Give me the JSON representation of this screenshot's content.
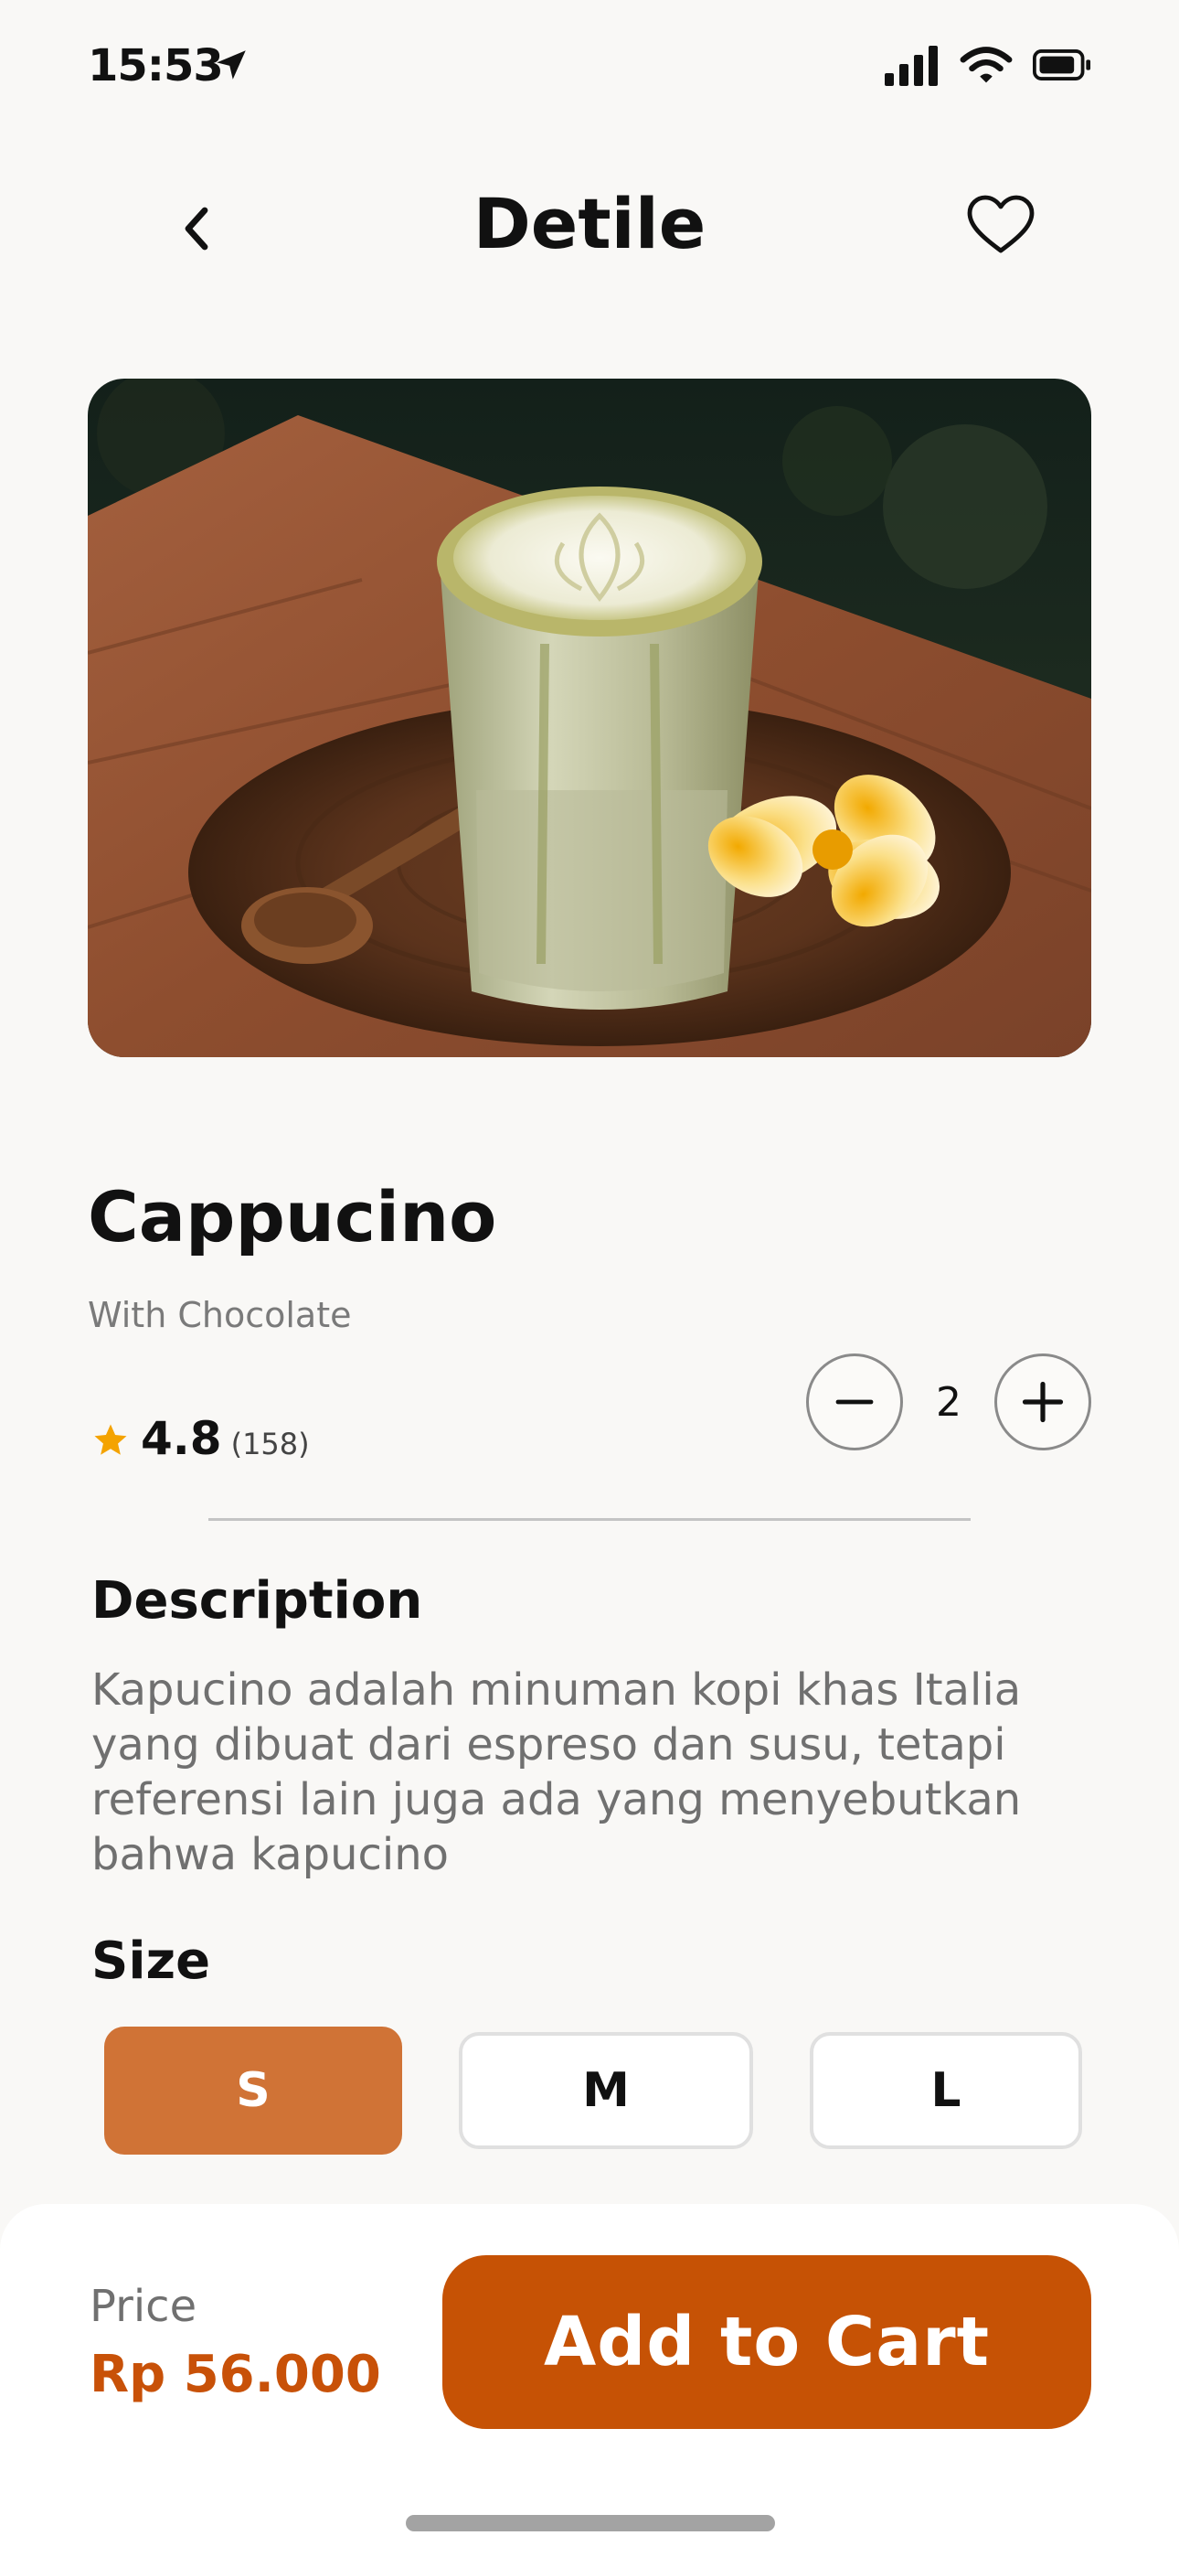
{
  "status_bar": {
    "time": "15:53"
  },
  "header": {
    "title": "Detile"
  },
  "product": {
    "name": "Cappucino",
    "subtitle": "With Chocolate",
    "rating": "4.8",
    "rating_count": "(158)",
    "quantity": "2"
  },
  "description": {
    "title": "Description",
    "text": "Kapucino adalah minuman kopi khas Italia yang dibuat dari espreso dan susu, tetapi referensi lain juga ada yang menyebutkan bahwa kapucino"
  },
  "size": {
    "title": "Size",
    "options": [
      "S",
      "M",
      "L"
    ],
    "selected": "S"
  },
  "footer": {
    "price_label": "Price",
    "price": "Rp 56.000",
    "cta": "Add to Cart"
  },
  "colors": {
    "accent": "#c65205",
    "selected_size": "#d07336",
    "star": "#f4a300"
  }
}
